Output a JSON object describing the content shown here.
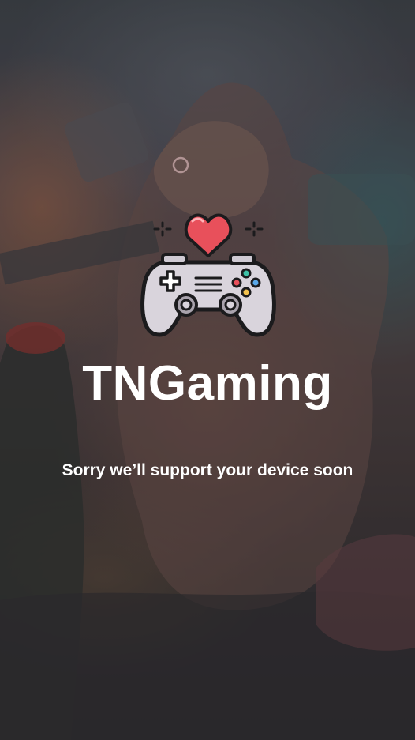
{
  "app": {
    "name": "TNGaming",
    "message": "Sorry we’ll support your device soon"
  },
  "logo": {
    "icon": "gamepad-heart-icon",
    "heart_color": "#e8505b",
    "controller_color": "#d9d4dc",
    "outline_color": "#1b1b1d"
  },
  "background": {
    "description_icon": "gaming-artwork-background"
  }
}
